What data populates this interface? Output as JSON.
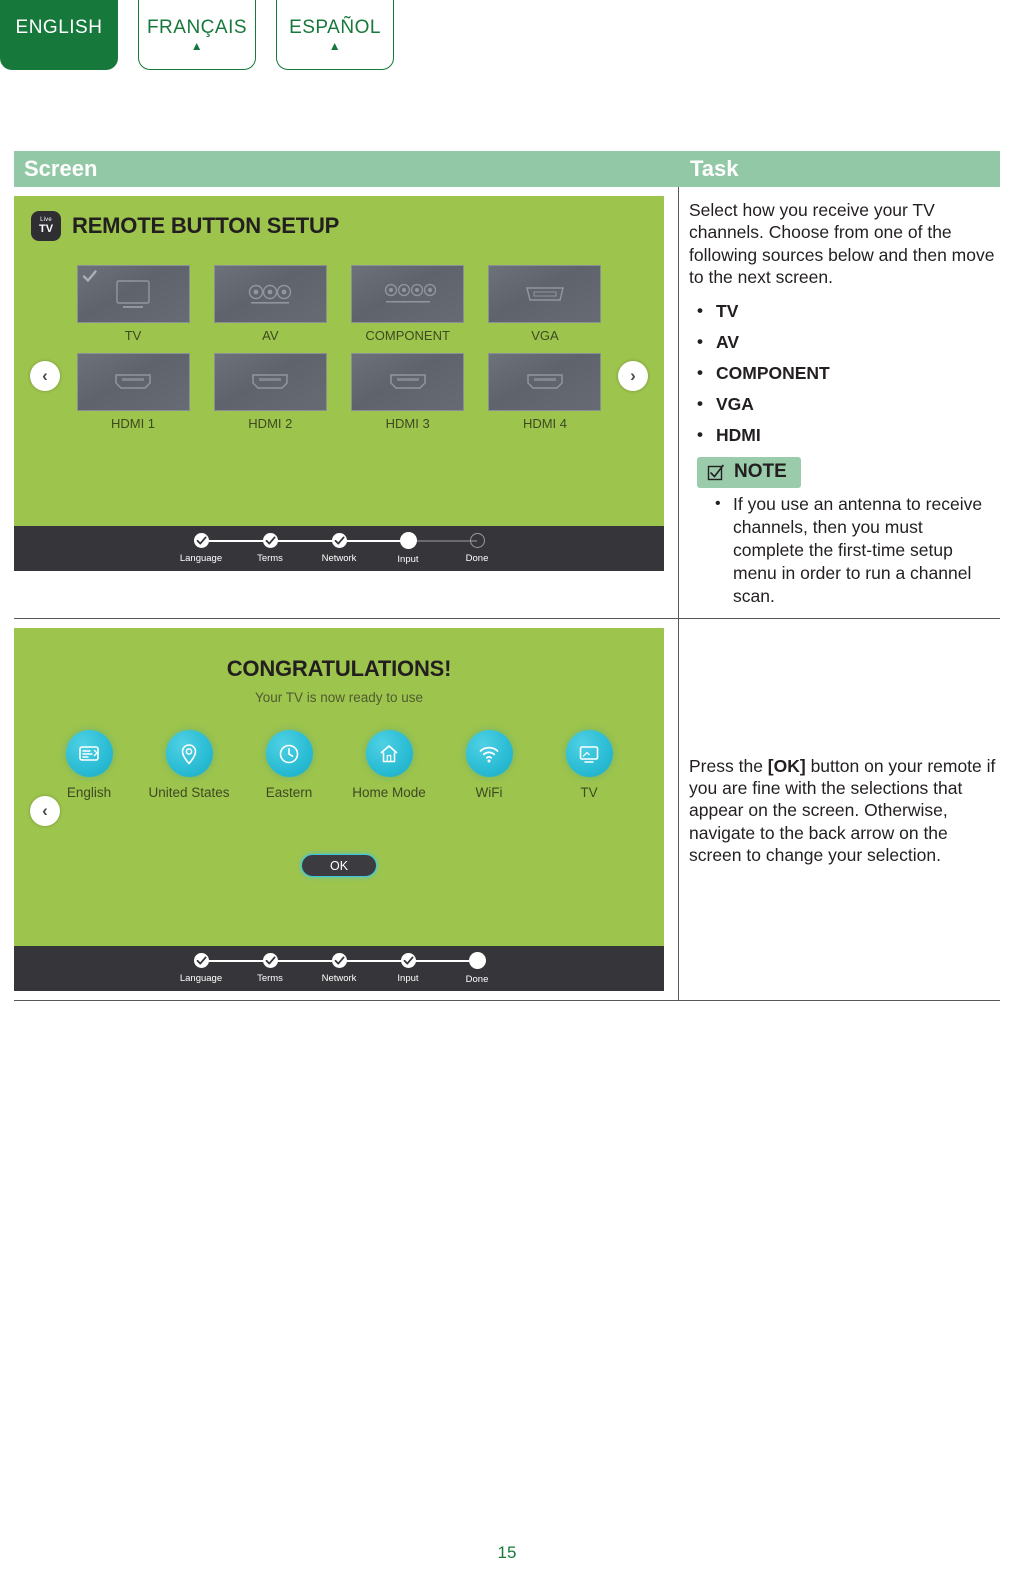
{
  "language_tabs": [
    {
      "label": "ENGLISH",
      "active": true,
      "caret": "▲"
    },
    {
      "label": "FRANÇAIS",
      "active": false,
      "caret": "▲"
    },
    {
      "label": "ESPAÑOL",
      "active": false,
      "caret": "▲"
    }
  ],
  "table": {
    "headers": {
      "screen": "Screen",
      "task": "Task"
    }
  },
  "row1": {
    "screen": {
      "app_icon": {
        "top": "Live",
        "bottom": "TV"
      },
      "title": "REMOTE BUTTON SETUP",
      "tiles_row1": [
        {
          "label": "TV",
          "icon": "tv-icon",
          "selected": true
        },
        {
          "label": "AV",
          "icon": "av-jacks-icon",
          "selected": false
        },
        {
          "label": "COMPONENT",
          "icon": "component-jacks-icon",
          "selected": false
        },
        {
          "label": "VGA",
          "icon": "vga-port-icon",
          "selected": false
        }
      ],
      "tiles_row2": [
        {
          "label": "HDMI 1",
          "icon": "hdmi-port-icon",
          "selected": false
        },
        {
          "label": "HDMI 2",
          "icon": "hdmi-port-icon",
          "selected": false
        },
        {
          "label": "HDMI 3",
          "icon": "hdmi-port-icon",
          "selected": false
        },
        {
          "label": "HDMI 4",
          "icon": "hdmi-port-icon",
          "selected": false
        }
      ],
      "nav_left": "‹",
      "nav_right": "›",
      "stepper": [
        {
          "label": "Language",
          "state": "done"
        },
        {
          "label": "Terms",
          "state": "done"
        },
        {
          "label": "Network",
          "state": "done"
        },
        {
          "label": "Input",
          "state": "current"
        },
        {
          "label": "Done",
          "state": "todo"
        }
      ]
    },
    "task": {
      "paragraph": "Select how you receive your TV channels. Choose from one of the following sources below and then move to the next screen.",
      "sources": [
        "TV",
        "AV",
        "COMPONENT",
        "VGA",
        "HDMI"
      ],
      "note_label": "NOTE",
      "note_items": [
        "If you use an antenna to receive channels, then you must complete the first-time setup menu in order to run a channel scan."
      ]
    }
  },
  "row2": {
    "screen": {
      "title": "CONGRATULATIONS!",
      "subtitle": "Your TV is now ready to use",
      "summary": [
        {
          "label": "English",
          "icon": "language-icon"
        },
        {
          "label": "United States",
          "icon": "location-pin-icon"
        },
        {
          "label": "Eastern",
          "icon": "clock-icon"
        },
        {
          "label": "Home Mode",
          "icon": "home-icon"
        },
        {
          "label": "WiFi",
          "icon": "wifi-icon"
        },
        {
          "label": "TV",
          "icon": "tv-icon"
        }
      ],
      "ok_button": "OK",
      "nav_left": "‹",
      "stepper": [
        {
          "label": "Language",
          "state": "done"
        },
        {
          "label": "Terms",
          "state": "done"
        },
        {
          "label": "Network",
          "state": "done"
        },
        {
          "label": "Input",
          "state": "done"
        },
        {
          "label": "Done",
          "state": "current"
        }
      ]
    },
    "task": {
      "text_before": "Press the ",
      "bold_key": "[OK]",
      "text_after": " button on your remote if you are fine with the selections that appear on the screen. Otherwise, navigate to the back arrow on the screen to change your selection."
    }
  },
  "page_number": "15",
  "colors": {
    "brand_green": "#17783c",
    "header_green": "#92c8a6",
    "screen_green": "#9dc44d",
    "stepper_dark": "#36363a",
    "icon_cyan": "#29bcd4"
  }
}
